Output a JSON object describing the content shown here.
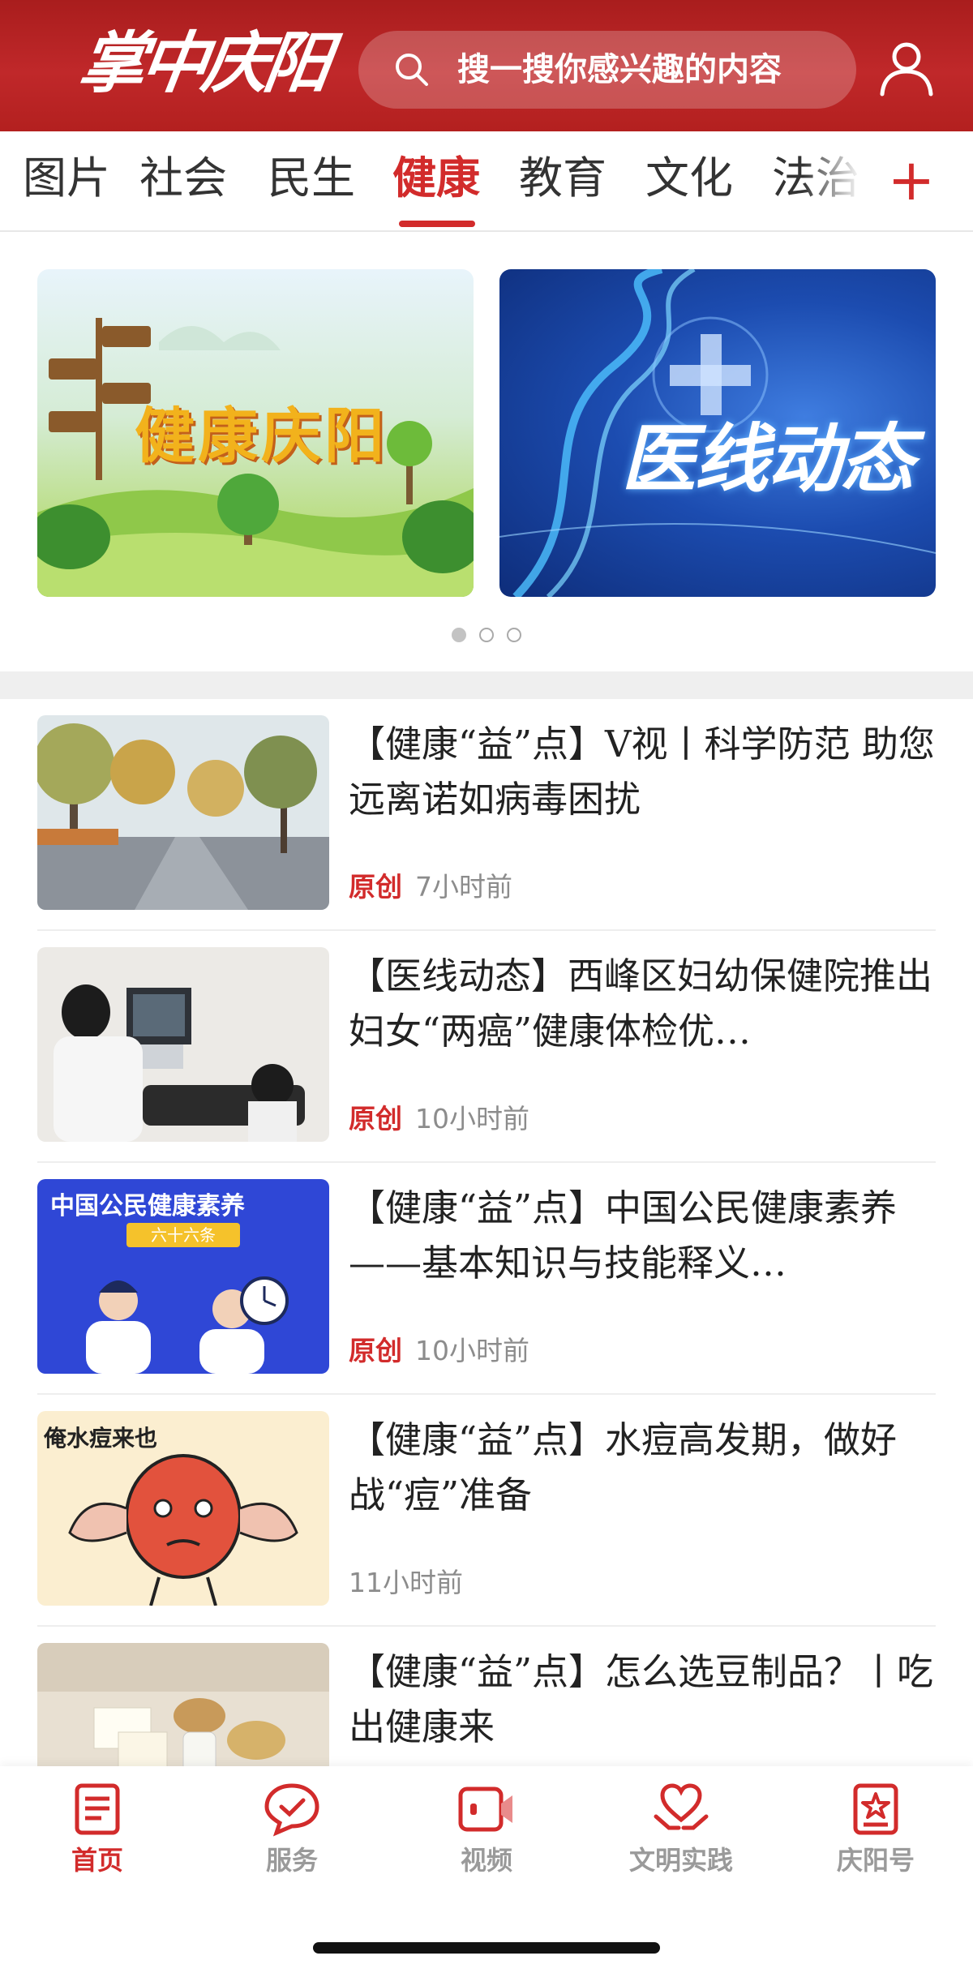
{
  "header": {
    "logo_text": "掌中庆阳",
    "search_placeholder": "搜一搜你感兴趣的内容"
  },
  "tabs": [
    {
      "label": "图片"
    },
    {
      "label": "社会"
    },
    {
      "label": "民生"
    },
    {
      "label": "健康",
      "active": true
    },
    {
      "label": "教育"
    },
    {
      "label": "文化"
    },
    {
      "label": "法治"
    }
  ],
  "tabs_more": "+",
  "banner": {
    "cards": [
      {
        "text": "健康庆阳"
      },
      {
        "text": "医线动态"
      }
    ],
    "dots_count": 3,
    "active_dot": 0
  },
  "news": [
    {
      "title": "【健康“益”点】V视丨科学防范 助您远离诺如病毒困扰",
      "original": "原创",
      "time": "7小时前"
    },
    {
      "title": "【医线动态】西峰区妇幼保健院推出妇女“两癌”健康体检优…",
      "original": "原创",
      "time": "10小时前"
    },
    {
      "title": "【健康“益”点】中国公民健康素养——基本知识与技能释义…",
      "original": "原创",
      "time": "10小时前",
      "thumb_text": "中国公民健康素养",
      "thumb_sub": "六十六条"
    },
    {
      "title": "【健康“益”点】水痘高发期，做好战“痘”准备",
      "original": "",
      "time": "11小时前",
      "thumb_text": "俺水痘来也"
    },
    {
      "title": "【健康“益”点】怎么选豆制品？丨吃出健康来",
      "original": "",
      "time": ""
    }
  ],
  "bottom_nav": [
    {
      "label": "首页",
      "icon": "home-doc-icon",
      "active": true
    },
    {
      "label": "服务",
      "icon": "chat-check-icon"
    },
    {
      "label": "视频",
      "icon": "video-icon"
    },
    {
      "label": "文明实践",
      "icon": "heart-hands-icon"
    },
    {
      "label": "庆阳号",
      "icon": "star-badge-icon"
    }
  ],
  "colors": {
    "brand_red": "#d22b2b",
    "header_red": "#b3201f",
    "muted": "#8c8c8c"
  }
}
